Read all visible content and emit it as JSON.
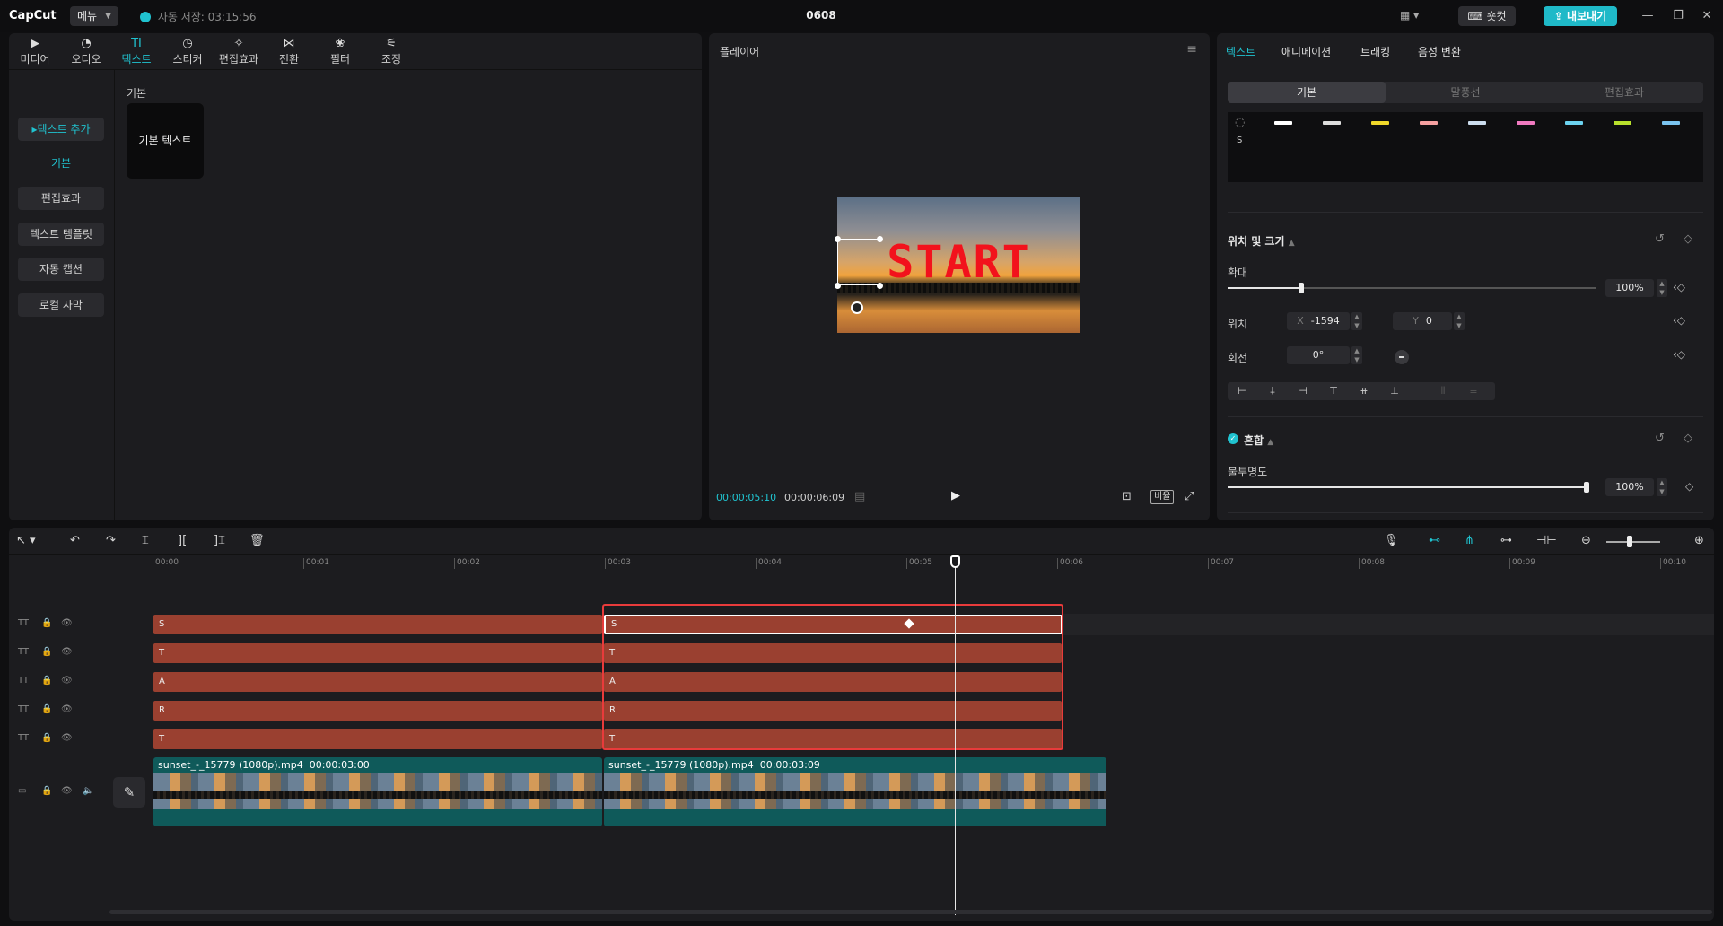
{
  "titlebar": {
    "logo": "CapCut",
    "menu_label": "메뉴",
    "autosave": "자동 저장: 03:15:56",
    "project_title": "0608",
    "shortcut_label": "숏컷",
    "export_label": "내보내기"
  },
  "media_panel": {
    "tabs": [
      {
        "label": "미디어",
        "icon": "media-icon"
      },
      {
        "label": "오디오",
        "icon": "audio-icon"
      },
      {
        "label": "텍스트",
        "icon": "text-icon"
      },
      {
        "label": "스티커",
        "icon": "sticker-icon"
      },
      {
        "label": "편집효과",
        "icon": "effects-icon"
      },
      {
        "label": "전환",
        "icon": "transition-icon"
      },
      {
        "label": "필터",
        "icon": "filter-icon"
      },
      {
        "label": "조정",
        "icon": "adjust-icon"
      }
    ],
    "active_tab": "텍스트",
    "side_nav": [
      "텍스트 추가",
      "기본",
      "편집효과",
      "텍스트 템플릿",
      "자동 캡션",
      "로컬 자막"
    ],
    "section_label": "기본",
    "card_label": "기본 텍스트"
  },
  "player": {
    "title": "플레이어",
    "overlay_text": "START",
    "current_time": "00:00:05:10",
    "total_time": "00:00:06:09",
    "ratio_label": "비율"
  },
  "properties": {
    "tabs": [
      "텍스트",
      "애니메이션",
      "트래킹",
      "음성 변환"
    ],
    "active_tab": "텍스트",
    "sub_tabs": [
      "기본",
      "말풍선",
      "편집효과"
    ],
    "preset_s": "S",
    "position_size": {
      "title": "위치 및 크기",
      "scale_label": "확대",
      "scale_value": "100%",
      "scale_fraction": 0.2,
      "position_label": "위치",
      "x_prefix": "X",
      "x_value": "-1594",
      "y_prefix": "Y",
      "y_value": "0",
      "rotation_label": "회전",
      "rotation_value": "0°"
    },
    "blend": {
      "title": "혼합",
      "opacity_label": "불투명도",
      "opacity_value": "100%"
    },
    "colors": {
      "accent": "#20c3d0",
      "clip": "#9a4030",
      "video_clip": "#0f5a5a",
      "highlight": "#e83b3b"
    }
  },
  "timeline": {
    "ruler": [
      "00:00",
      "00:01",
      "00:02",
      "00:03",
      "00:04",
      "00:05",
      "00:06",
      "00:07",
      "00:08",
      "00:09",
      "00:10"
    ],
    "text_tracks": [
      {
        "clip1": "S",
        "clip2": "S"
      },
      {
        "clip1": "T",
        "clip2": "T"
      },
      {
        "clip1": "A",
        "clip2": "A"
      },
      {
        "clip1": "R",
        "clip2": "R"
      },
      {
        "clip1": "T",
        "clip2": "T"
      }
    ],
    "video_clips": [
      {
        "label": "sunset_-_15779 (1080p).mp4",
        "duration": "00:00:03:00"
      },
      {
        "label": "sunset_-_15779 (1080p).mp4",
        "duration": "00:00:03:09"
      }
    ]
  }
}
